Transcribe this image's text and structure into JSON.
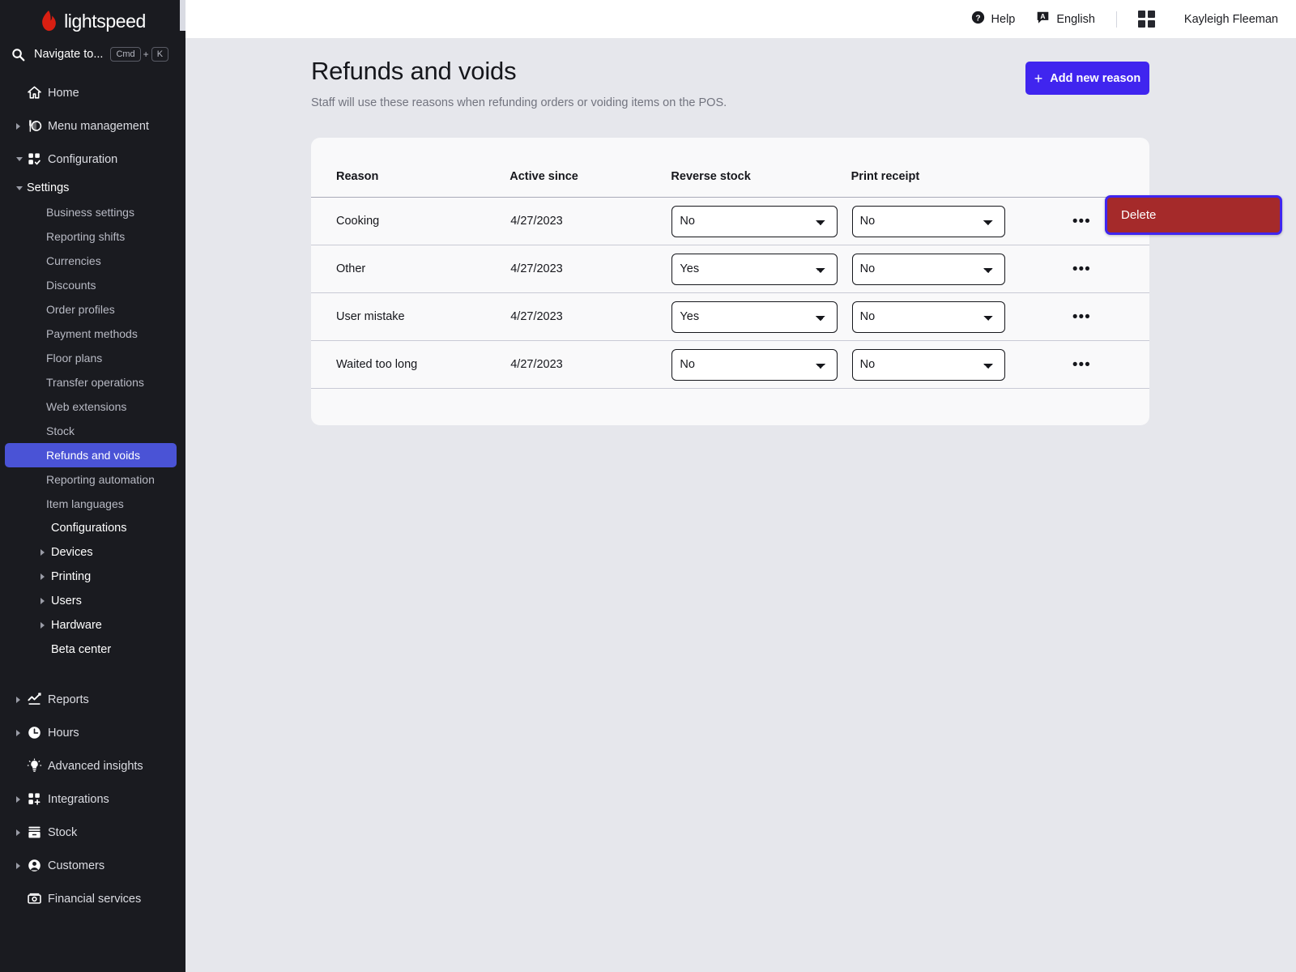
{
  "brand": {
    "name": "lightspeed",
    "accent": "#4025ef",
    "sidebar_bg": "#1a1b20"
  },
  "sidebar": {
    "search": {
      "label": "Navigate to...",
      "key1": "Cmd",
      "plus": "+",
      "key2": "K",
      "icon": "search-icon"
    },
    "items": [
      {
        "label": "Home",
        "icon": "home-icon",
        "level": 1,
        "caret": "none"
      },
      {
        "label": "Menu management",
        "icon": "menu-management-icon",
        "level": 1,
        "caret": "right"
      },
      {
        "label": "Configuration",
        "icon": "configuration-icon",
        "level": 1,
        "caret": "down"
      },
      {
        "label": "Settings",
        "icon": "none",
        "level": 2,
        "caret": "down"
      },
      {
        "label": "Business settings",
        "icon": "none",
        "level": 3,
        "caret": "none"
      },
      {
        "label": "Reporting shifts",
        "icon": "none",
        "level": 3,
        "caret": "none"
      },
      {
        "label": "Currencies",
        "icon": "none",
        "level": 3,
        "caret": "none"
      },
      {
        "label": "Discounts",
        "icon": "none",
        "level": 3,
        "caret": "none"
      },
      {
        "label": "Order profiles",
        "icon": "none",
        "level": 3,
        "caret": "none"
      },
      {
        "label": "Payment methods",
        "icon": "none",
        "level": 3,
        "caret": "none"
      },
      {
        "label": "Floor plans",
        "icon": "none",
        "level": 3,
        "caret": "none"
      },
      {
        "label": "Transfer operations",
        "icon": "none",
        "level": 3,
        "caret": "none"
      },
      {
        "label": "Web extensions",
        "icon": "none",
        "level": 3,
        "caret": "none"
      },
      {
        "label": "Stock",
        "icon": "none",
        "level": 3,
        "caret": "none"
      },
      {
        "label": "Refunds and voids",
        "icon": "none",
        "level": 3,
        "caret": "none",
        "selected": true
      },
      {
        "label": "Reporting automation",
        "icon": "none",
        "level": 3,
        "caret": "none"
      },
      {
        "label": "Item languages",
        "icon": "none",
        "level": 3,
        "caret": "none"
      },
      {
        "label": "Configurations",
        "icon": "none",
        "level": 2,
        "caret": "none"
      },
      {
        "label": "Devices",
        "icon": "none",
        "level": 2,
        "caret": "right"
      },
      {
        "label": "Printing",
        "icon": "none",
        "level": 2,
        "caret": "right"
      },
      {
        "label": "Users",
        "icon": "none",
        "level": 2,
        "caret": "right"
      },
      {
        "label": "Hardware",
        "icon": "none",
        "level": 2,
        "caret": "right"
      },
      {
        "label": "Beta center",
        "icon": "none",
        "level": 2,
        "caret": "none"
      },
      {
        "label": "Reports",
        "icon": "reports-chart-icon",
        "level": 1,
        "caret": "right",
        "gap_before": true
      },
      {
        "label": "Hours",
        "icon": "clock-icon",
        "level": 1,
        "caret": "right"
      },
      {
        "label": "Advanced insights",
        "icon": "lightbulb-icon",
        "level": 1,
        "caret": "none"
      },
      {
        "label": "Integrations",
        "icon": "integrations-grid-plus-icon",
        "level": 1,
        "caret": "right"
      },
      {
        "label": "Stock",
        "icon": "stock-box-icon",
        "level": 1,
        "caret": "right"
      },
      {
        "label": "Customers",
        "icon": "customer-person-icon",
        "level": 1,
        "caret": "right"
      },
      {
        "label": "Financial services",
        "icon": "money-icon",
        "level": 1,
        "caret": "none"
      }
    ]
  },
  "topbar": {
    "help": {
      "label": "Help",
      "icon": "help-circle-icon"
    },
    "language": {
      "label": "English",
      "icon": "language-badge-icon",
      "badge": "A"
    },
    "apps": {
      "icon": "apps-grid-icon"
    },
    "user": {
      "name": "Kayleigh Fleeman"
    }
  },
  "page": {
    "title": "Refunds and voids",
    "subtitle": "Staff will use these reasons when refunding orders or voiding items on the POS.",
    "add_button": {
      "label": "Add new reason",
      "icon": "plus-icon"
    }
  },
  "table": {
    "columns": [
      "Reason",
      "Active since",
      "Reverse stock",
      "Print receipt",
      ""
    ],
    "select_options": [
      "Yes",
      "No"
    ],
    "rows": [
      {
        "reason": "Cooking",
        "active_since": "4/27/2023",
        "reverse_stock": "No",
        "print_receipt": "No",
        "menu_icon": "ellipsis-icon"
      },
      {
        "reason": "Other",
        "active_since": "4/27/2023",
        "reverse_stock": "Yes",
        "print_receipt": "No",
        "menu_icon": "ellipsis-icon"
      },
      {
        "reason": "User mistake",
        "active_since": "4/27/2023",
        "reverse_stock": "Yes",
        "print_receipt": "No",
        "menu_icon": "ellipsis-icon"
      },
      {
        "reason": "Waited too long",
        "active_since": "4/27/2023",
        "reverse_stock": "No",
        "print_receipt": "No",
        "menu_icon": "ellipsis-icon"
      }
    ]
  },
  "context_menu": {
    "delete_label": "Delete",
    "bg": "#a52a2a",
    "focus_ring": "#4025ef"
  }
}
